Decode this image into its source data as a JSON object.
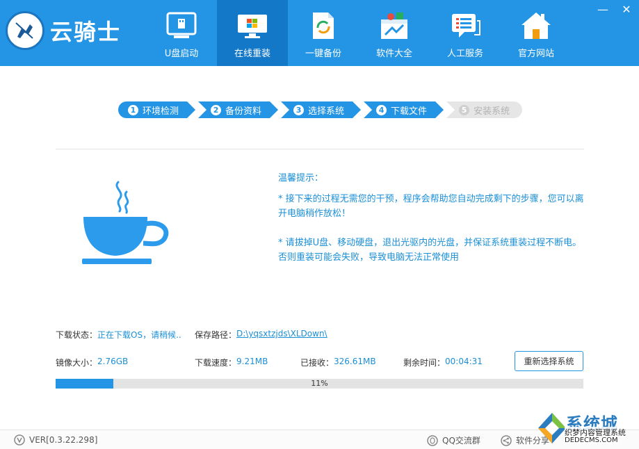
{
  "app": {
    "logo_text": "云骑士",
    "accent": "#2494e4"
  },
  "nav": [
    {
      "label": "U盘启动",
      "icon": "usb-drive-icon"
    },
    {
      "label": "在线重装",
      "icon": "windows-monitor-icon"
    },
    {
      "label": "一键备份",
      "icon": "backup-document-icon"
    },
    {
      "label": "软件大全",
      "icon": "software-box-icon"
    },
    {
      "label": "人工服务",
      "icon": "chat-service-icon"
    },
    {
      "label": "官方网站",
      "icon": "home-icon"
    }
  ],
  "window": {
    "minimize": "—",
    "close": "✕"
  },
  "steps": [
    {
      "num": "1",
      "label": "环境检测"
    },
    {
      "num": "2",
      "label": "备份资料"
    },
    {
      "num": "3",
      "label": "选择系统"
    },
    {
      "num": "4",
      "label": "下载文件"
    },
    {
      "num": "5",
      "label": "安装系统"
    }
  ],
  "tips": {
    "title": "温馨提示：",
    "line1": "* 接下来的过程无需您的干预，程序会帮助您自动完成剩下的步骤，您可以离开电脑稍作放松！",
    "line2": "* 请拔掉U盘、移动硬盘，退出光驱内的光盘，并保证系统重装过程不断电。否则重装可能会失败，导致电脑无法正常使用"
  },
  "status": {
    "download_label": "下载状态：",
    "download_value": "正在下载OS，请稍候..",
    "path_label": "保存路径：",
    "path_value": "D:\\yqsxtzjds\\XLDown\\",
    "size_label": "镜像大小：",
    "size_value": "2.76GB",
    "speed_label": "下载速度：",
    "speed_value": "9.21MB",
    "received_label": "已接收：",
    "received_value": "326.61MB",
    "remaining_label": "剩余时间：",
    "remaining_value": "00:04:31",
    "reselect_label": "重新选择系统"
  },
  "progress": {
    "percent": 11,
    "label": "11%"
  },
  "footer": {
    "version": "VER[0.3.22.298]",
    "qq_group": "QQ交流群",
    "share": "软件分享"
  },
  "watermark": {
    "brand": "系统城",
    "line1": "织梦内容管理系统",
    "line2": "DEDECMS.COM"
  }
}
